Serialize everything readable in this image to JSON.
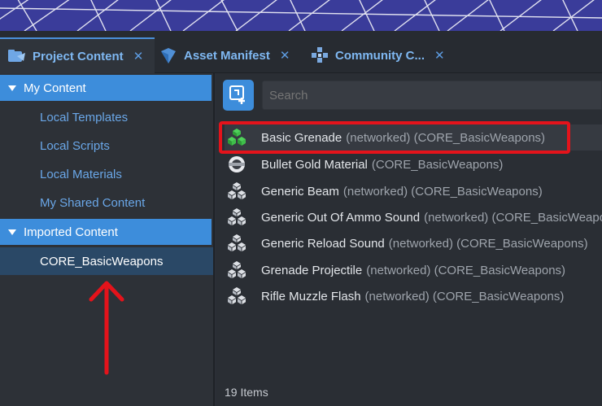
{
  "tabs": [
    {
      "label": "Project Content",
      "icon": "project-content-icon",
      "active": true
    },
    {
      "label": "Asset Manifest",
      "icon": "asset-manifest-icon",
      "active": false
    },
    {
      "label": "Community C...",
      "icon": "community-content-icon",
      "active": false
    }
  ],
  "close_glyph": "✕",
  "sidebar": {
    "my_content": {
      "label": "My Content",
      "items": [
        "Local Templates",
        "Local Scripts",
        "Local Materials",
        "My Shared Content"
      ]
    },
    "imported_content": {
      "label": "Imported Content",
      "items": [
        "CORE_BasicWeapons"
      ]
    }
  },
  "search": {
    "placeholder": "Search"
  },
  "items": [
    {
      "name": "Basic Grenade",
      "meta": "(networked) (CORE_BasicWeapons)",
      "icon": "green-template-icon",
      "highlighted": true
    },
    {
      "name": "Bullet Gold Material",
      "meta": "(CORE_BasicWeapons)",
      "icon": "material-sphere-icon",
      "highlighted": false
    },
    {
      "name": "Generic Beam",
      "meta": "(networked) (CORE_BasicWeapons)",
      "icon": "template-icon",
      "highlighted": false
    },
    {
      "name": "Generic Out Of Ammo Sound",
      "meta": "(networked) (CORE_BasicWeapons)",
      "icon": "template-icon",
      "highlighted": false
    },
    {
      "name": "Generic Reload Sound",
      "meta": "(networked) (CORE_BasicWeapons)",
      "icon": "template-icon",
      "highlighted": false
    },
    {
      "name": "Grenade Projectile",
      "meta": "(networked) (CORE_BasicWeapons)",
      "icon": "template-icon",
      "highlighted": false
    },
    {
      "name": "Rifle Muzzle Flash",
      "meta": "(networked) (CORE_BasicWeapons)",
      "icon": "template-icon",
      "highlighted": false
    }
  ],
  "footer": {
    "count": "19 Items"
  },
  "colors": {
    "accent": "#3d8ddb",
    "tab_text": "#7fb8f2",
    "annotation_red": "#e4131b",
    "template_green": "#3fbf4a"
  }
}
